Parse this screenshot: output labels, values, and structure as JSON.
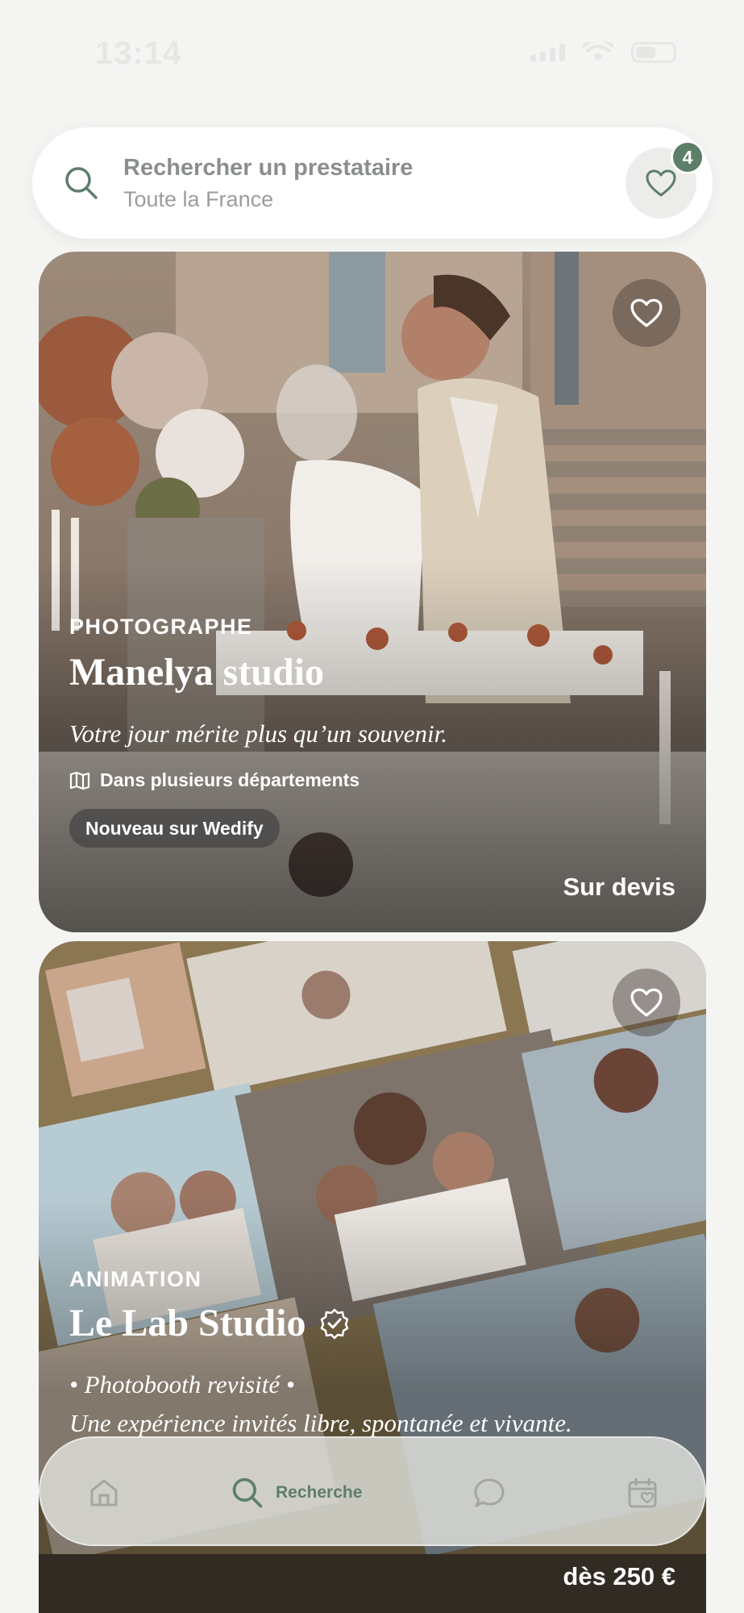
{
  "status": {
    "time": "13:14"
  },
  "search": {
    "title": "Rechercher un prestataire",
    "subtitle": "Toute la France",
    "favorites_count": "4"
  },
  "cards": [
    {
      "category": "PHOTOGRAPHE",
      "name": "Manelya studio",
      "tagline": "Votre jour mérite plus qu’un souvenir.",
      "location": "Dans plusieurs départements",
      "badge": "Nouveau sur Wedify",
      "price": "Sur devis"
    },
    {
      "category": "ANIMATION",
      "name": "Le Lab Studio",
      "tagline_line1": "• Photobooth revisité •",
      "tagline_line2": "Une expérience invités libre, spontanée et vivante.",
      "price": "dès 250 €",
      "verified": true
    }
  ],
  "tab_bar": {
    "items": [
      {
        "icon": "home-icon",
        "label": ""
      },
      {
        "icon": "search-icon",
        "label": "Recherche",
        "active": true
      },
      {
        "icon": "chat-bubble-icon",
        "label": ""
      },
      {
        "icon": "calendar-heart-icon",
        "label": ""
      }
    ]
  },
  "colors": {
    "accent": "#5d7e69",
    "background": "#f4f5f3",
    "muted_text": "#8a8f8b"
  }
}
